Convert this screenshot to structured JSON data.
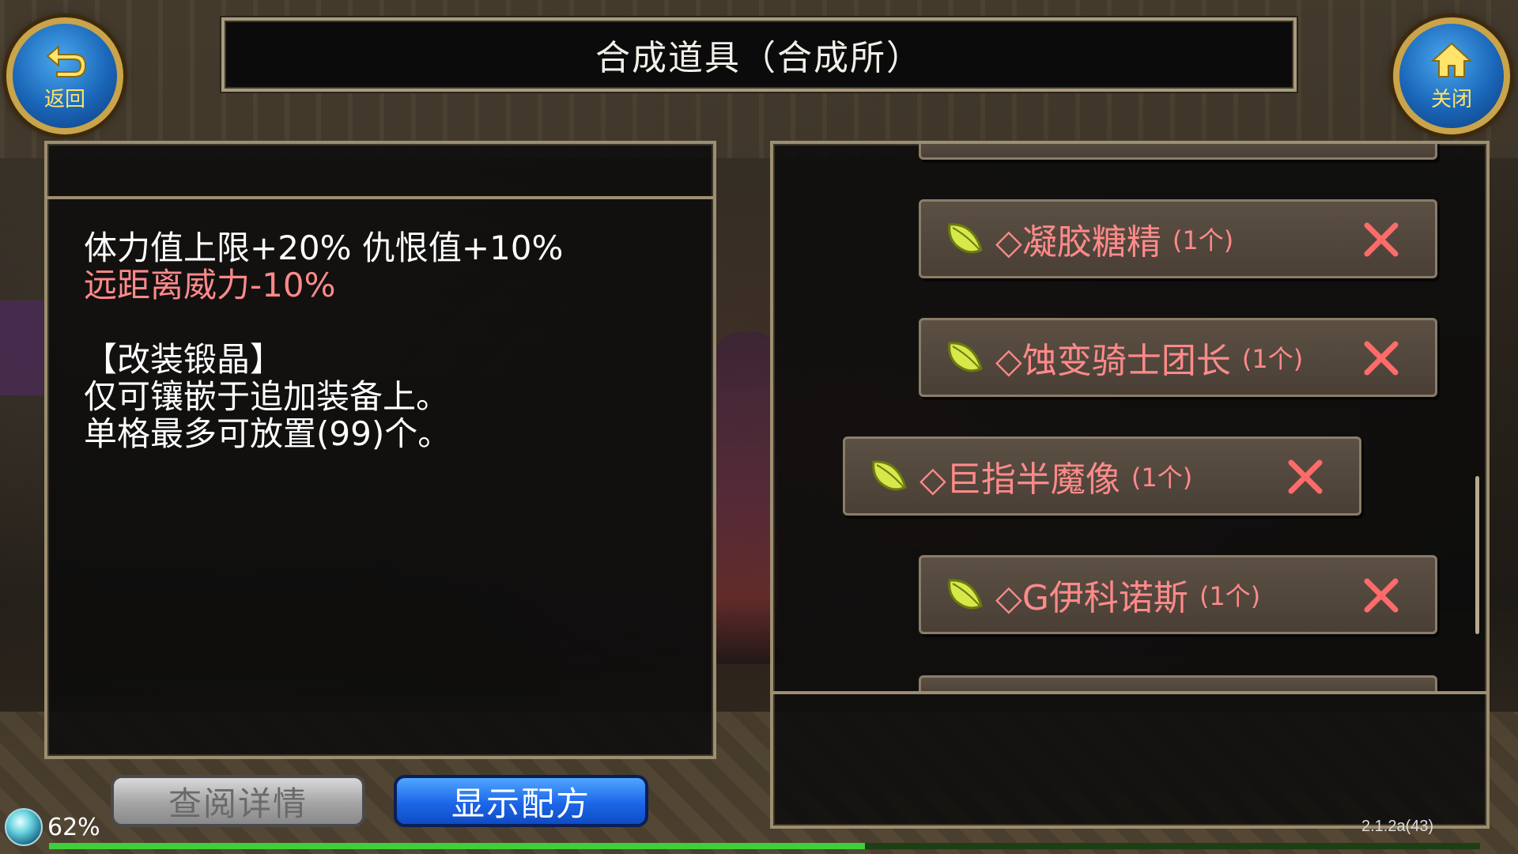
{
  "header": {
    "title": "合成道具（合成所）",
    "back_label": "返回",
    "close_label": "关闭"
  },
  "detail": {
    "line1": "体力值上限+20% 仇恨值+10%",
    "line2": "远距离威力-10%",
    "line3": "【改装锻晶】",
    "line4": "仅可镶嵌于追加装备上。",
    "line5": "单格最多可放置(99)个。"
  },
  "buttons": {
    "details_label": "查阅详情",
    "recipe_label": "显示配方"
  },
  "items": [
    {
      "name": "◇凝胶糖精",
      "count": "(1个)"
    },
    {
      "name": "◇蚀变骑士团长",
      "count": "(1个)"
    },
    {
      "name": "◇巨指半魔像",
      "count": "(1个)"
    },
    {
      "name": "◇G伊科诺斯",
      "count": "(1个)"
    }
  ],
  "status": {
    "battery": "62%",
    "version": "2.1.2a(43)",
    "progress_fraction": 0.57
  },
  "colors": {
    "accent_red": "#ff8a8a",
    "button_blue": "#1d66e8",
    "frame": "#9c8e70"
  }
}
